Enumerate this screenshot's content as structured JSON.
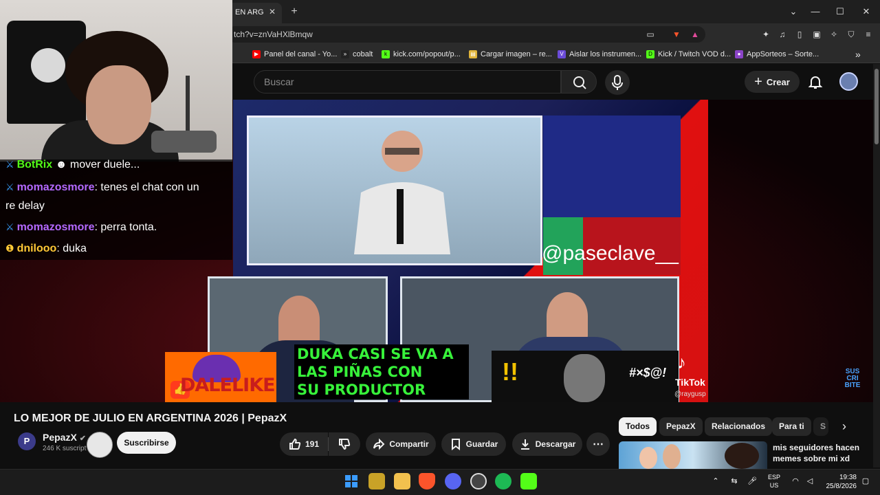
{
  "browser": {
    "tab_title": "EN ARG",
    "tab_close": "✕",
    "new_tab": "+",
    "url": "tch?v=znVaHXlBmqw",
    "window_controls": [
      "⌄",
      "—",
      "☐",
      "✕"
    ],
    "bookmarks": [
      {
        "label": "Panel del canal - Yo...",
        "icon": "youtube-icon",
        "color": "#ff0000"
      },
      {
        "label": "cobalt",
        "icon": "cobalt-icon",
        "color": "#222222"
      },
      {
        "label": "kick.com/popout/p...",
        "icon": "kick-icon",
        "color": "#53fc18"
      },
      {
        "label": "Cargar imagen – re...",
        "icon": "image-icon",
        "color": "#e0b43a"
      },
      {
        "label": "Aislar los instrumen...",
        "icon": "vocal-icon",
        "color": "#6b4bd8"
      },
      {
        "label": "Kick / Twitch VOD d...",
        "icon": "kick-vod-icon",
        "color": "#53fc18"
      },
      {
        "label": "AppSorteos – Sorte...",
        "icon": "appsorteos-icon",
        "color": "#8b44c8"
      }
    ],
    "bookmarks_more": "»"
  },
  "youtube": {
    "search_placeholder": "Buscar",
    "create_label": "Crear",
    "video": {
      "handle": "@paseclave__",
      "caption_lines": [
        "DUKA CASI SE VA A",
        "LAS PIÑAS CON",
        "SU PRODUCTOR"
      ],
      "dalelike": "DALELIKE",
      "tiktok_label": "TikTok",
      "tiktok_user": "@raygusp",
      "react_text": "#×$@!",
      "subscribe_brand": [
        "SUS",
        "CRI",
        "BITE"
      ]
    },
    "title": "LO MEJOR DE JULIO EN ARGENTINA 2026 | PepazX",
    "channel": {
      "name": "PepazX",
      "avatar_letter": "P",
      "subscribers": "246 K suscript",
      "subscribe_label": "Suscribirse"
    },
    "actions": {
      "likes": "191",
      "share": "Compartir",
      "save": "Guardar",
      "download": "Descargar",
      "more": "⋯"
    },
    "chips": [
      "Todos",
      "PepazX",
      "Relacionados",
      "Para ti",
      "S"
    ],
    "chips_next": "›",
    "recommendation": {
      "title": "mis seguidores hacen memes sobre mi xd"
    }
  },
  "overlay_chat": [
    {
      "user": "BotRix",
      "message": "mover duele...",
      "badge": "sword",
      "color": "green"
    },
    {
      "user": "momazosmore",
      "message": ": tenes el chat con un",
      "badge": "sword",
      "color": "purple"
    },
    {
      "user": "",
      "message": "re delay",
      "badge": "",
      "color": "none"
    },
    {
      "user": "momazosmore",
      "message": ": perra tonta.",
      "badge": "sword",
      "color": "purple"
    },
    {
      "user": "dnilooo",
      "message": ": duka",
      "badge": "gift",
      "color": "yellow"
    }
  ],
  "taskbar": {
    "language": [
      "ESP",
      "US"
    ],
    "time": "19:38",
    "date": "25/8/2026",
    "apps": [
      {
        "name": "windows-start-icon",
        "color": "#3b9cff"
      },
      {
        "name": "media-player-icon",
        "color": "#c9a227"
      },
      {
        "name": "file-explorer-icon",
        "color": "#f2c14e"
      },
      {
        "name": "brave-browser-icon",
        "color": "#fb542b"
      },
      {
        "name": "discord-icon",
        "color": "#5865f2"
      },
      {
        "name": "obs-icon",
        "color": "#444444"
      },
      {
        "name": "spotify-icon",
        "color": "#1db954"
      },
      {
        "name": "kick-app-icon",
        "color": "#53fc18"
      }
    ]
  }
}
